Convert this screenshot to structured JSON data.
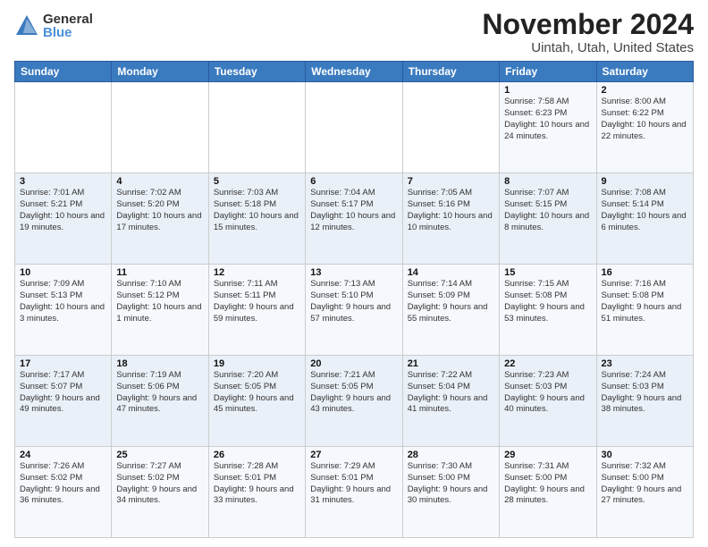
{
  "header": {
    "logo": {
      "general": "General",
      "blue": "Blue"
    },
    "title": "November 2024",
    "location": "Uintah, Utah, United States"
  },
  "weekdays": [
    "Sunday",
    "Monday",
    "Tuesday",
    "Wednesday",
    "Thursday",
    "Friday",
    "Saturday"
  ],
  "weeks": [
    [
      {
        "day": "",
        "info": ""
      },
      {
        "day": "",
        "info": ""
      },
      {
        "day": "",
        "info": ""
      },
      {
        "day": "",
        "info": ""
      },
      {
        "day": "",
        "info": ""
      },
      {
        "day": "1",
        "info": "Sunrise: 7:58 AM\nSunset: 6:23 PM\nDaylight: 10 hours\nand 24 minutes."
      },
      {
        "day": "2",
        "info": "Sunrise: 8:00 AM\nSunset: 6:22 PM\nDaylight: 10 hours\nand 22 minutes."
      }
    ],
    [
      {
        "day": "3",
        "info": "Sunrise: 7:01 AM\nSunset: 5:21 PM\nDaylight: 10 hours\nand 19 minutes."
      },
      {
        "day": "4",
        "info": "Sunrise: 7:02 AM\nSunset: 5:20 PM\nDaylight: 10 hours\nand 17 minutes."
      },
      {
        "day": "5",
        "info": "Sunrise: 7:03 AM\nSunset: 5:18 PM\nDaylight: 10 hours\nand 15 minutes."
      },
      {
        "day": "6",
        "info": "Sunrise: 7:04 AM\nSunset: 5:17 PM\nDaylight: 10 hours\nand 12 minutes."
      },
      {
        "day": "7",
        "info": "Sunrise: 7:05 AM\nSunset: 5:16 PM\nDaylight: 10 hours\nand 10 minutes."
      },
      {
        "day": "8",
        "info": "Sunrise: 7:07 AM\nSunset: 5:15 PM\nDaylight: 10 hours\nand 8 minutes."
      },
      {
        "day": "9",
        "info": "Sunrise: 7:08 AM\nSunset: 5:14 PM\nDaylight: 10 hours\nand 6 minutes."
      }
    ],
    [
      {
        "day": "10",
        "info": "Sunrise: 7:09 AM\nSunset: 5:13 PM\nDaylight: 10 hours\nand 3 minutes."
      },
      {
        "day": "11",
        "info": "Sunrise: 7:10 AM\nSunset: 5:12 PM\nDaylight: 10 hours\nand 1 minute."
      },
      {
        "day": "12",
        "info": "Sunrise: 7:11 AM\nSunset: 5:11 PM\nDaylight: 9 hours\nand 59 minutes."
      },
      {
        "day": "13",
        "info": "Sunrise: 7:13 AM\nSunset: 5:10 PM\nDaylight: 9 hours\nand 57 minutes."
      },
      {
        "day": "14",
        "info": "Sunrise: 7:14 AM\nSunset: 5:09 PM\nDaylight: 9 hours\nand 55 minutes."
      },
      {
        "day": "15",
        "info": "Sunrise: 7:15 AM\nSunset: 5:08 PM\nDaylight: 9 hours\nand 53 minutes."
      },
      {
        "day": "16",
        "info": "Sunrise: 7:16 AM\nSunset: 5:08 PM\nDaylight: 9 hours\nand 51 minutes."
      }
    ],
    [
      {
        "day": "17",
        "info": "Sunrise: 7:17 AM\nSunset: 5:07 PM\nDaylight: 9 hours\nand 49 minutes."
      },
      {
        "day": "18",
        "info": "Sunrise: 7:19 AM\nSunset: 5:06 PM\nDaylight: 9 hours\nand 47 minutes."
      },
      {
        "day": "19",
        "info": "Sunrise: 7:20 AM\nSunset: 5:05 PM\nDaylight: 9 hours\nand 45 minutes."
      },
      {
        "day": "20",
        "info": "Sunrise: 7:21 AM\nSunset: 5:05 PM\nDaylight: 9 hours\nand 43 minutes."
      },
      {
        "day": "21",
        "info": "Sunrise: 7:22 AM\nSunset: 5:04 PM\nDaylight: 9 hours\nand 41 minutes."
      },
      {
        "day": "22",
        "info": "Sunrise: 7:23 AM\nSunset: 5:03 PM\nDaylight: 9 hours\nand 40 minutes."
      },
      {
        "day": "23",
        "info": "Sunrise: 7:24 AM\nSunset: 5:03 PM\nDaylight: 9 hours\nand 38 minutes."
      }
    ],
    [
      {
        "day": "24",
        "info": "Sunrise: 7:26 AM\nSunset: 5:02 PM\nDaylight: 9 hours\nand 36 minutes."
      },
      {
        "day": "25",
        "info": "Sunrise: 7:27 AM\nSunset: 5:02 PM\nDaylight: 9 hours\nand 34 minutes."
      },
      {
        "day": "26",
        "info": "Sunrise: 7:28 AM\nSunset: 5:01 PM\nDaylight: 9 hours\nand 33 minutes."
      },
      {
        "day": "27",
        "info": "Sunrise: 7:29 AM\nSunset: 5:01 PM\nDaylight: 9 hours\nand 31 minutes."
      },
      {
        "day": "28",
        "info": "Sunrise: 7:30 AM\nSunset: 5:00 PM\nDaylight: 9 hours\nand 30 minutes."
      },
      {
        "day": "29",
        "info": "Sunrise: 7:31 AM\nSunset: 5:00 PM\nDaylight: 9 hours\nand 28 minutes."
      },
      {
        "day": "30",
        "info": "Sunrise: 7:32 AM\nSunset: 5:00 PM\nDaylight: 9 hours\nand 27 minutes."
      }
    ]
  ]
}
